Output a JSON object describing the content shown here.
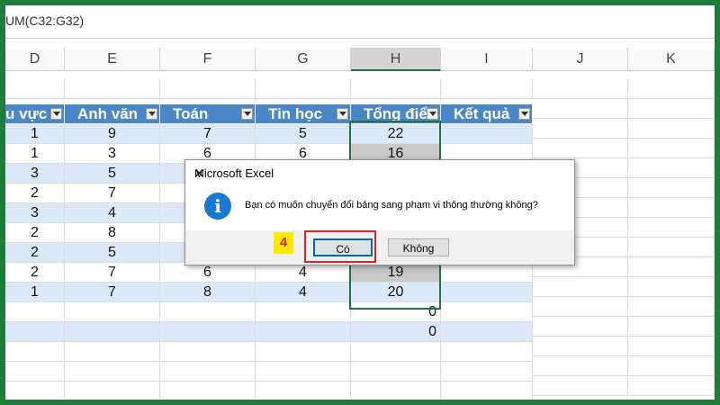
{
  "formula_bar": {
    "text": "UM(C32:G32)"
  },
  "columns": [
    "D",
    "E",
    "F",
    "G",
    "H",
    "I",
    "J",
    "K"
  ],
  "table": {
    "headers": [
      "u vực",
      "Anh văn",
      "Toán",
      "Tin học",
      "Tổng điể",
      "Kết quả"
    ],
    "rows": [
      [
        "1",
        "9",
        "7",
        "5",
        "22",
        ""
      ],
      [
        "1",
        "3",
        "6",
        "6",
        "16",
        ""
      ],
      [
        "3",
        "5",
        "",
        "",
        "",
        ""
      ],
      [
        "2",
        "7",
        "",
        "",
        "",
        ""
      ],
      [
        "3",
        "4",
        "",
        "",
        "",
        ""
      ],
      [
        "2",
        "8",
        "",
        "",
        "",
        ""
      ],
      [
        "2",
        "5",
        "",
        "",
        "",
        ""
      ],
      [
        "2",
        "7",
        "6",
        "4",
        "19",
        ""
      ],
      [
        "1",
        "7",
        "8",
        "4",
        "20",
        ""
      ]
    ],
    "totals": [
      "0",
      "0"
    ]
  },
  "dialog": {
    "title": "Microsoft Excel",
    "close_symbol": "✕",
    "icon": "info-icon",
    "icon_glyph": "i",
    "message": "Bạn có muốn chuyển đổi bảng sang phạm vi thông thường không?",
    "yes_label": "Có",
    "no_label": "Không"
  },
  "annotation": {
    "step": "4"
  },
  "colors": {
    "header_blue": "#4a86c8",
    "band": "#dbe8f7",
    "frame_green": "#1e7d3a",
    "highlight": "#d62424"
  }
}
